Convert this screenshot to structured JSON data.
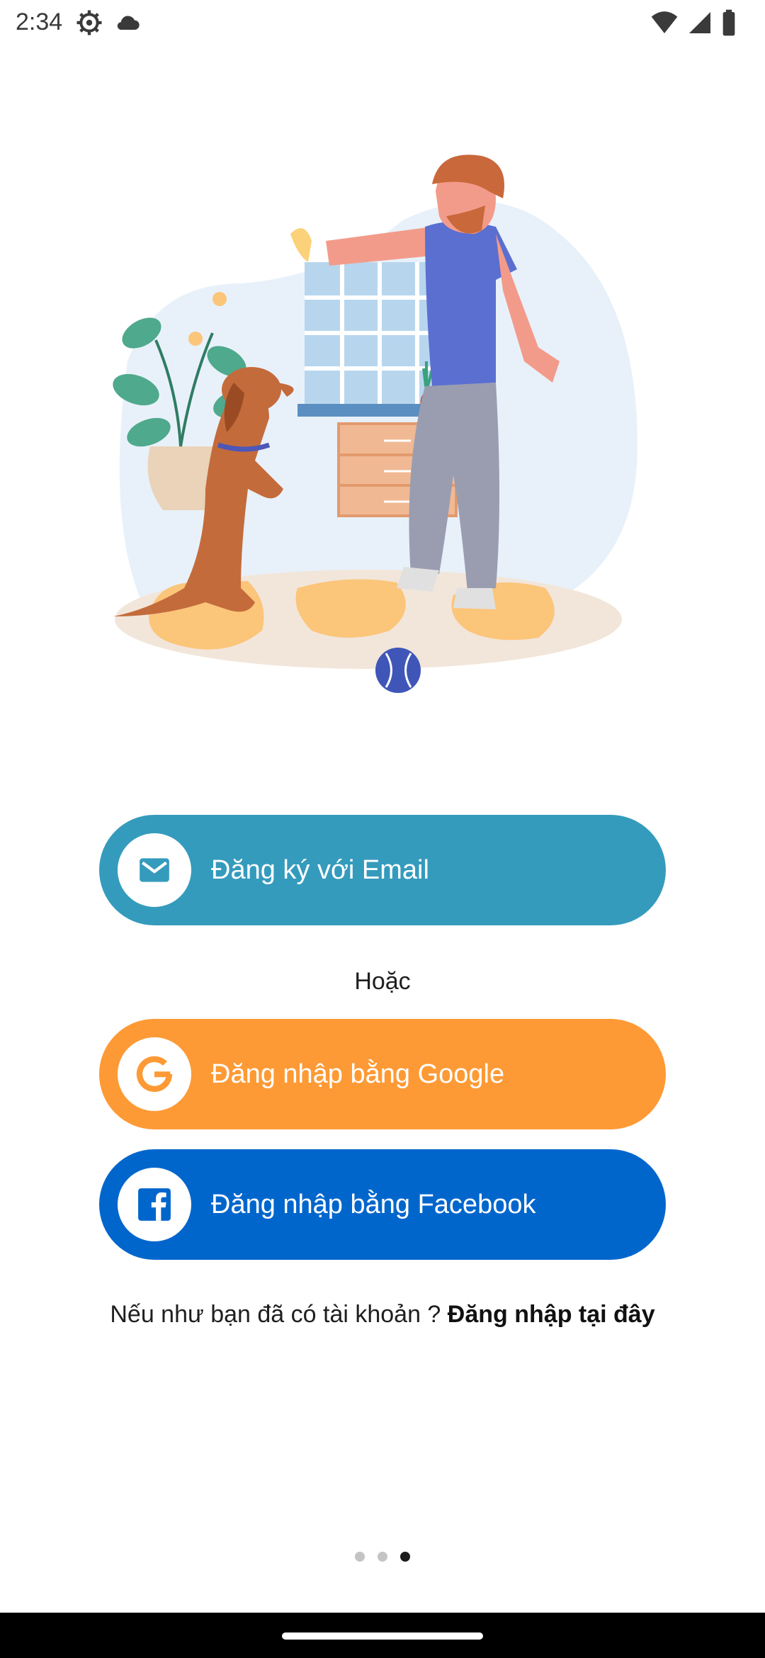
{
  "status_bar": {
    "time": "2:34",
    "left_icons": [
      "settings-icon",
      "cloud-icon"
    ],
    "right_icons": [
      "wifi-icon",
      "signal-icon",
      "battery-icon"
    ]
  },
  "illustration": {
    "description_icon": "man-with-dog-illustration"
  },
  "buttons": {
    "email": {
      "label": "Đăng ký với Email",
      "icon": "mail-icon",
      "color": "#359bbd"
    },
    "google": {
      "label": "Đăng nhập bằng Google",
      "icon": "google-icon",
      "color": "#fd9a35"
    },
    "facebook": {
      "label": "Đăng nhập bằng Facebook",
      "icon": "facebook-icon",
      "color": "#0166cc"
    }
  },
  "or_text": "Hoặc",
  "login_prompt": {
    "text": "Nếu như bạn đã có tài khoản ? ",
    "link": "Đăng nhập tại đây"
  },
  "pager": {
    "count": 3,
    "active_index": 2
  }
}
